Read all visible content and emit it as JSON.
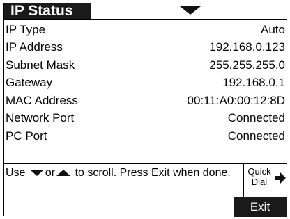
{
  "header": {
    "title": "IP Status",
    "dropdown_icon": "triangle-down-icon"
  },
  "rows": [
    {
      "label": "IP Type",
      "value": "Auto"
    },
    {
      "label": "IP Address",
      "value": "192.168.0.123"
    },
    {
      "label": "Subnet Mask",
      "value": "255.255.255.0"
    },
    {
      "label": "Gateway",
      "value": "192.168.0.1"
    },
    {
      "label": "MAC Address",
      "value": "00:11:A0:00:12:8D"
    },
    {
      "label": "Network Port",
      "value": "Connected"
    },
    {
      "label": "PC Port",
      "value": "Connected"
    }
  ],
  "message": {
    "part1": "Use",
    "part2": "or",
    "part3": "to scroll. Press Exit when done."
  },
  "softkeys": {
    "quick_dial": "Quick Dial",
    "exit": "Exit"
  }
}
